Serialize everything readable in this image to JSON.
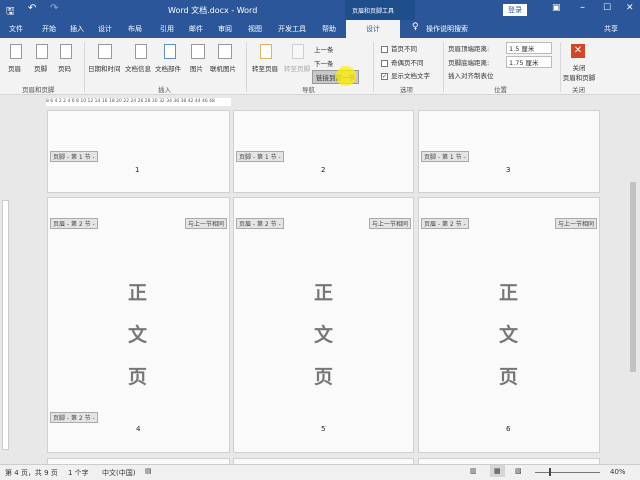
{
  "title": "Word 文档.docx - Word",
  "context_title": "页眉和页脚工具",
  "login": "登录",
  "share": "共享",
  "tell_me": "操作说明搜索",
  "tabs": [
    "文件",
    "开始",
    "插入",
    "设计",
    "布局",
    "引用",
    "邮件",
    "审阅",
    "视图",
    "开发工具",
    "帮助",
    "设计"
  ],
  "ribbon": {
    "header": "页眉",
    "footer": "页脚",
    "page_number": "页码",
    "group_hf": "页眉和页脚",
    "datetime": "日期和时间",
    "doc_info": "文档信息",
    "doc_parts": "文档部件",
    "picture": "图片",
    "online_picture": "联机图片",
    "group_insert": "插入",
    "goto_header": "转至页眉",
    "goto_footer": "转至页脚",
    "prev": "上一条",
    "next": "下一条",
    "link_prev": "链接到前一节",
    "group_nav": "导航",
    "diff_first": "首页不同",
    "diff_odd_even": "奇偶页不同",
    "show_text": "显示文档文字",
    "group_options": "选项",
    "header_top_label": "页眉顶端距离:",
    "header_top_value": "1.5 厘米",
    "footer_bottom_label": "页脚底端距离:",
    "footer_bottom_value": "1.75 厘米",
    "insert_align_tab": "插入对齐制表位",
    "group_position": "位置",
    "close_hf": "关闭\n页眉和页脚",
    "group_close": "关闭"
  },
  "ruler_text": "8 6 4 2   2 4 6 8 10 12 14 16 18 20 22 24 26 28 30 32 34 36 38    42 44 46 48",
  "pages": {
    "footer_s1": "页脚 - 第 1 节 -",
    "footer_s2": "页脚 - 第 2 节 -",
    "header_s2": "页眉 - 第 2 节 -",
    "same_as_prev": "与上一节相同",
    "nums": [
      "1",
      "2",
      "3",
      "4",
      "5",
      "6"
    ],
    "body": [
      "正",
      "文",
      "页"
    ]
  },
  "status": {
    "page": "第 4 页，共 9 页",
    "words": "1 个字",
    "lang": "中文(中国)",
    "zoom": "40%"
  },
  "accent": "#2b579a"
}
